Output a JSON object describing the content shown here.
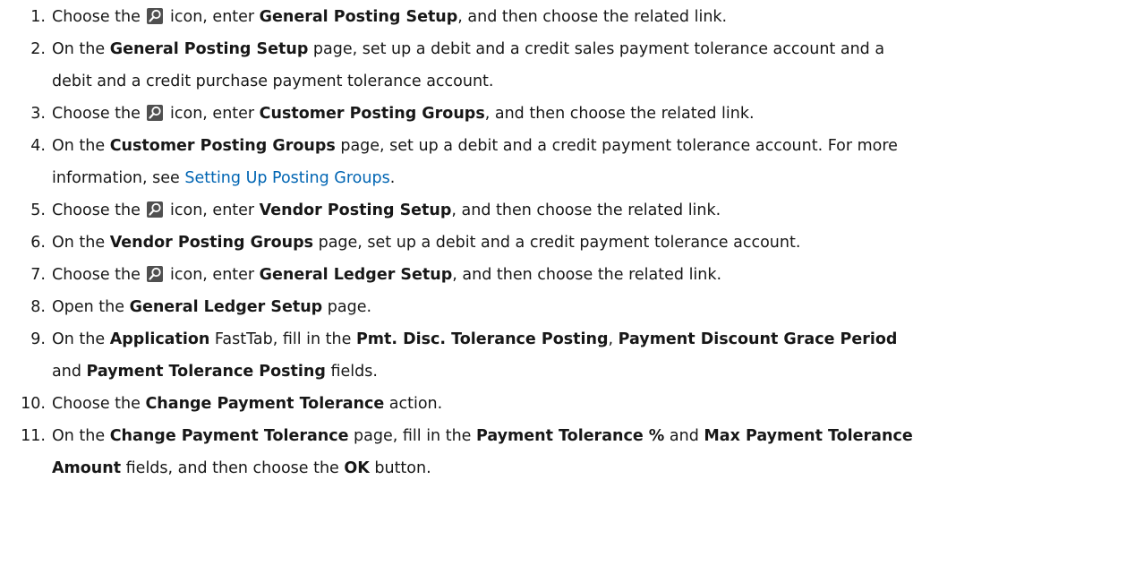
{
  "steps": [
    {
      "num": "1.",
      "lines": [
        [
          {
            "t": "Choose the "
          },
          {
            "icon": "search-icon"
          },
          {
            "t": " icon, enter "
          },
          {
            "b": "General Posting Setup"
          },
          {
            "t": ", and then choose the related link."
          }
        ]
      ]
    },
    {
      "num": "2.",
      "lines": [
        [
          {
            "t": "On the "
          },
          {
            "b": "General Posting Setup"
          },
          {
            "t": " page, set up a debit and a credit sales payment tolerance account and a"
          }
        ],
        [
          {
            "t": "debit and a credit purchase payment tolerance account."
          }
        ]
      ]
    },
    {
      "num": "3.",
      "lines": [
        [
          {
            "t": "Choose the "
          },
          {
            "icon": "search-icon"
          },
          {
            "t": " icon, enter "
          },
          {
            "b": "Customer Posting Groups"
          },
          {
            "t": ", and then choose the related link."
          }
        ]
      ]
    },
    {
      "num": "4.",
      "lines": [
        [
          {
            "t": "On the "
          },
          {
            "b": "Customer Posting Groups"
          },
          {
            "t": " page, set up a debit and a credit payment tolerance account. For more"
          }
        ],
        [
          {
            "t": "information, see "
          },
          {
            "link": "Setting Up Posting Groups"
          },
          {
            "t": "."
          }
        ]
      ]
    },
    {
      "num": "5.",
      "lines": [
        [
          {
            "t": "Choose the "
          },
          {
            "icon": "search-icon"
          },
          {
            "t": " icon, enter "
          },
          {
            "b": "Vendor Posting Setup"
          },
          {
            "t": ", and then choose the related link."
          }
        ]
      ]
    },
    {
      "num": "6.",
      "lines": [
        [
          {
            "t": "On the "
          },
          {
            "b": "Vendor Posting Groups"
          },
          {
            "t": " page, set up a debit and a credit payment tolerance account."
          }
        ]
      ]
    },
    {
      "num": "7.",
      "lines": [
        [
          {
            "t": "Choose the "
          },
          {
            "icon": "search-icon"
          },
          {
            "t": " icon, enter "
          },
          {
            "b": "General Ledger Setup"
          },
          {
            "t": ", and then choose the related link."
          }
        ]
      ]
    },
    {
      "num": "8.",
      "lines": [
        [
          {
            "t": "Open the "
          },
          {
            "b": "General Ledger Setup"
          },
          {
            "t": " page."
          }
        ]
      ]
    },
    {
      "num": "9.",
      "lines": [
        [
          {
            "t": "On the "
          },
          {
            "b": "Application"
          },
          {
            "t": " FastTab, fill in the "
          },
          {
            "b": "Pmt. Disc. Tolerance Posting"
          },
          {
            "t": ", "
          },
          {
            "b": "Payment Discount Grace Period"
          }
        ],
        [
          {
            "t": "and "
          },
          {
            "b": "Payment Tolerance Posting"
          },
          {
            "t": " fields."
          }
        ]
      ]
    },
    {
      "num": "10.",
      "lines": [
        [
          {
            "t": "Choose the "
          },
          {
            "b": "Change Payment Tolerance"
          },
          {
            "t": " action."
          }
        ]
      ]
    },
    {
      "num": "11.",
      "lines": [
        [
          {
            "t": "On the "
          },
          {
            "b": "Change Payment Tolerance"
          },
          {
            "t": " page, fill in the "
          },
          {
            "b": "Payment Tolerance %"
          },
          {
            "t": " and "
          },
          {
            "b": "Max Payment Tolerance"
          }
        ],
        [
          {
            "b": "Amount"
          },
          {
            "t": " fields, and then choose the "
          },
          {
            "b": "OK"
          },
          {
            "t": " button."
          }
        ]
      ]
    }
  ],
  "colors": {
    "text": "#171717",
    "link": "#0065b3",
    "icon_bg": "#505050"
  }
}
